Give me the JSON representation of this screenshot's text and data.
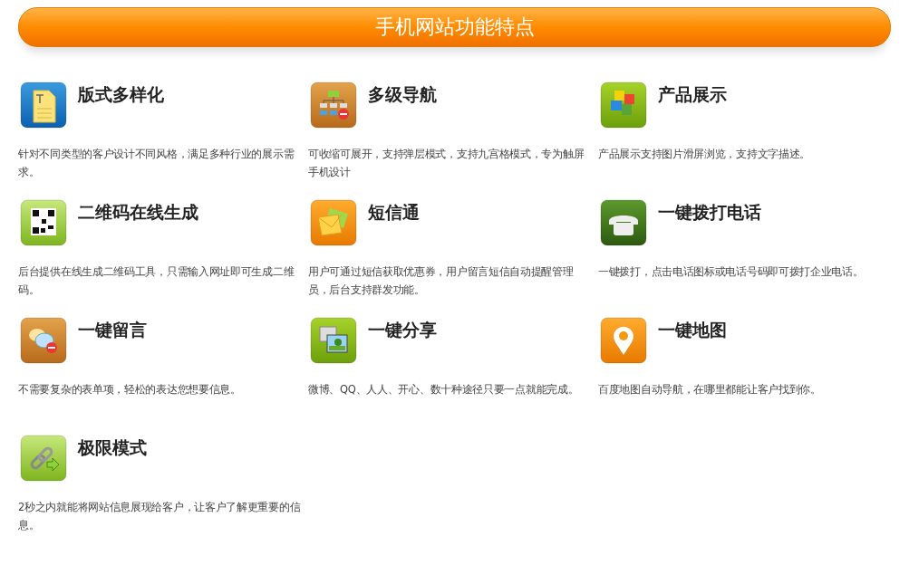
{
  "banner": {
    "title": "手机网站功能特点"
  },
  "features": [
    {
      "title": "版式多样化",
      "description": "针对不同类型的客户设计不同风格，满足多种行业的展示需求。"
    },
    {
      "title": "多级导航",
      "description": "可收缩可展开，支持弹层模式，支持九宫格模式，专为触屏手机设计"
    },
    {
      "title": "产品展示",
      "description": "产品展示支持图片滑屏浏览，支持文字描述。"
    },
    {
      "title": "二维码在线生成",
      "description": "后台提供在线生成二维码工具，只需输入网址即可生成二维码。"
    },
    {
      "title": "短信通",
      "description": "用户可通过短信获取优惠券，用户留言短信自动提醒管理员，后台支持群发功能。"
    },
    {
      "title": "一键拨打电话",
      "description": "一键拨打，点击电话图标或电话号码即可拨打企业电话。"
    },
    {
      "title": "一键留言",
      "description": "不需要复杂的表单项，轻松的表达您想要信息。"
    },
    {
      "title": "一键分享",
      "description": "微博、QQ、人人、开心、数十种途径只要一点就能完成。"
    },
    {
      "title": "一键地图",
      "description": "百度地图自动导航，在哪里都能让客户找到你。"
    },
    {
      "title": "极限模式",
      "description": "2秒之内就能将网站信息展现给客户，让客户了解更重要的信息。"
    }
  ]
}
